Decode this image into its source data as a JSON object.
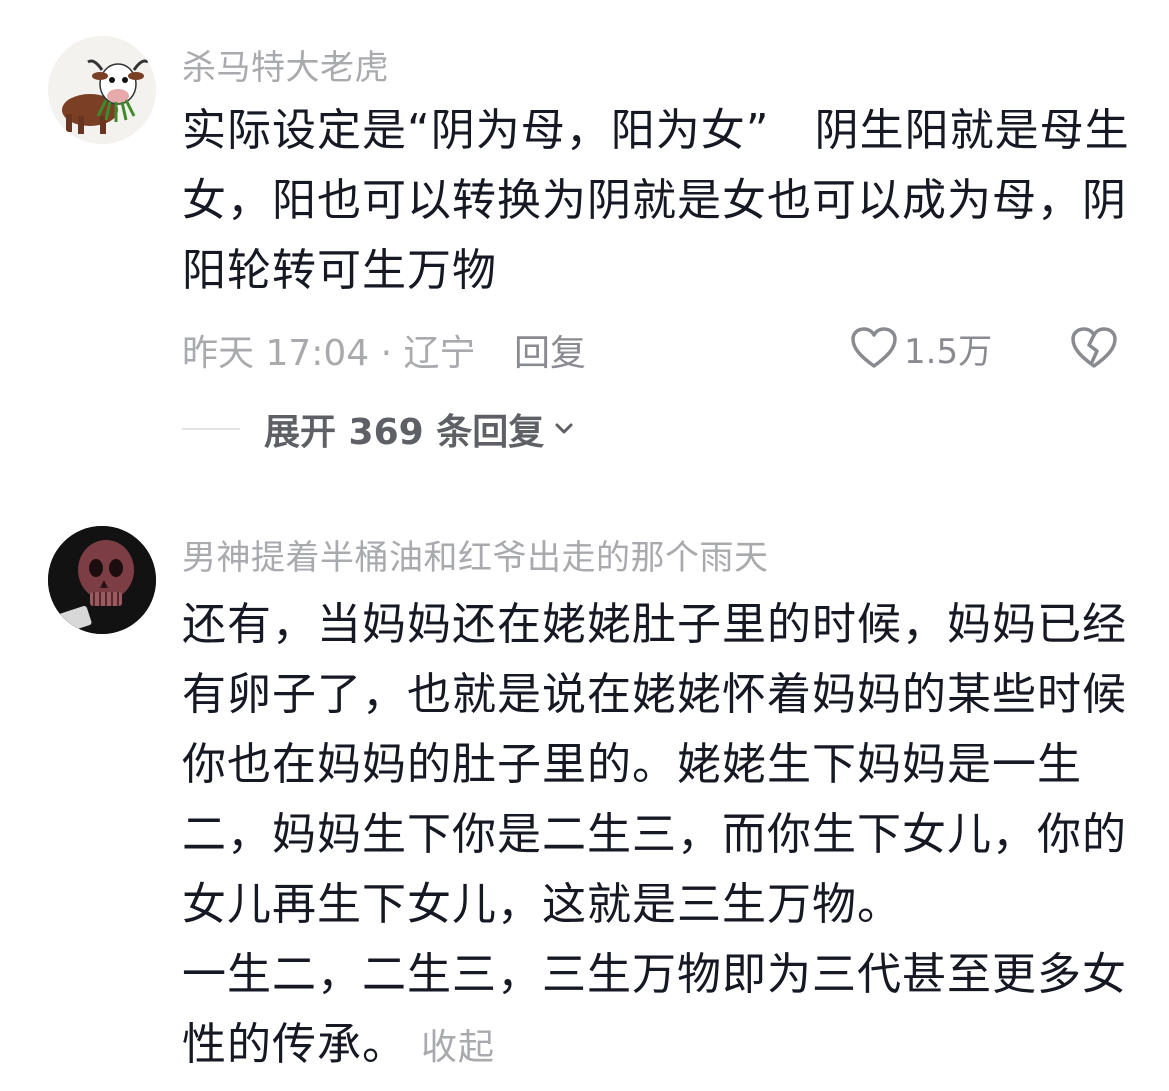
{
  "comments": [
    {
      "username": "杀马特大老虎",
      "avatar": "cow-avatar",
      "lines": [
        "实际设定是“阴为母，阳为女”　阴生阳就是母生",
        "女，阳也可以转换为阴就是女也可以成为母，阴",
        "阳轮转可生万物"
      ],
      "time_location": "昨天 17:04 · 辽宁",
      "reply_label": "回复",
      "like_count": "1.5万",
      "expand_label": "展开 369 条回复"
    },
    {
      "username": "男神提着半桶油和红爷出走的那个雨天",
      "avatar": "skull-avatar",
      "lines": [
        "还有，当妈妈还在姥姥肚子里的时候，妈妈已经",
        "有卵子了，也就是说在姥姥怀着妈妈的某些时候",
        "你也在妈妈的肚子里的。姥姥生下妈妈是一生",
        "二，妈妈生下你是二生三，而你生下女儿，你的",
        "女儿再生下女儿，这就是三生万物。",
        "一生二，二生三，三生万物即为三代甚至更多女"
      ],
      "last_line": "性的传承。",
      "collapse_label": "收起"
    }
  ],
  "icons": {
    "like": "heart-outline-icon",
    "dislike": "broken-heart-icon",
    "expand": "chevron-down-icon"
  },
  "colors": {
    "text": "#161823",
    "muted": "#a9aaae",
    "secondary": "#8a8b91"
  }
}
